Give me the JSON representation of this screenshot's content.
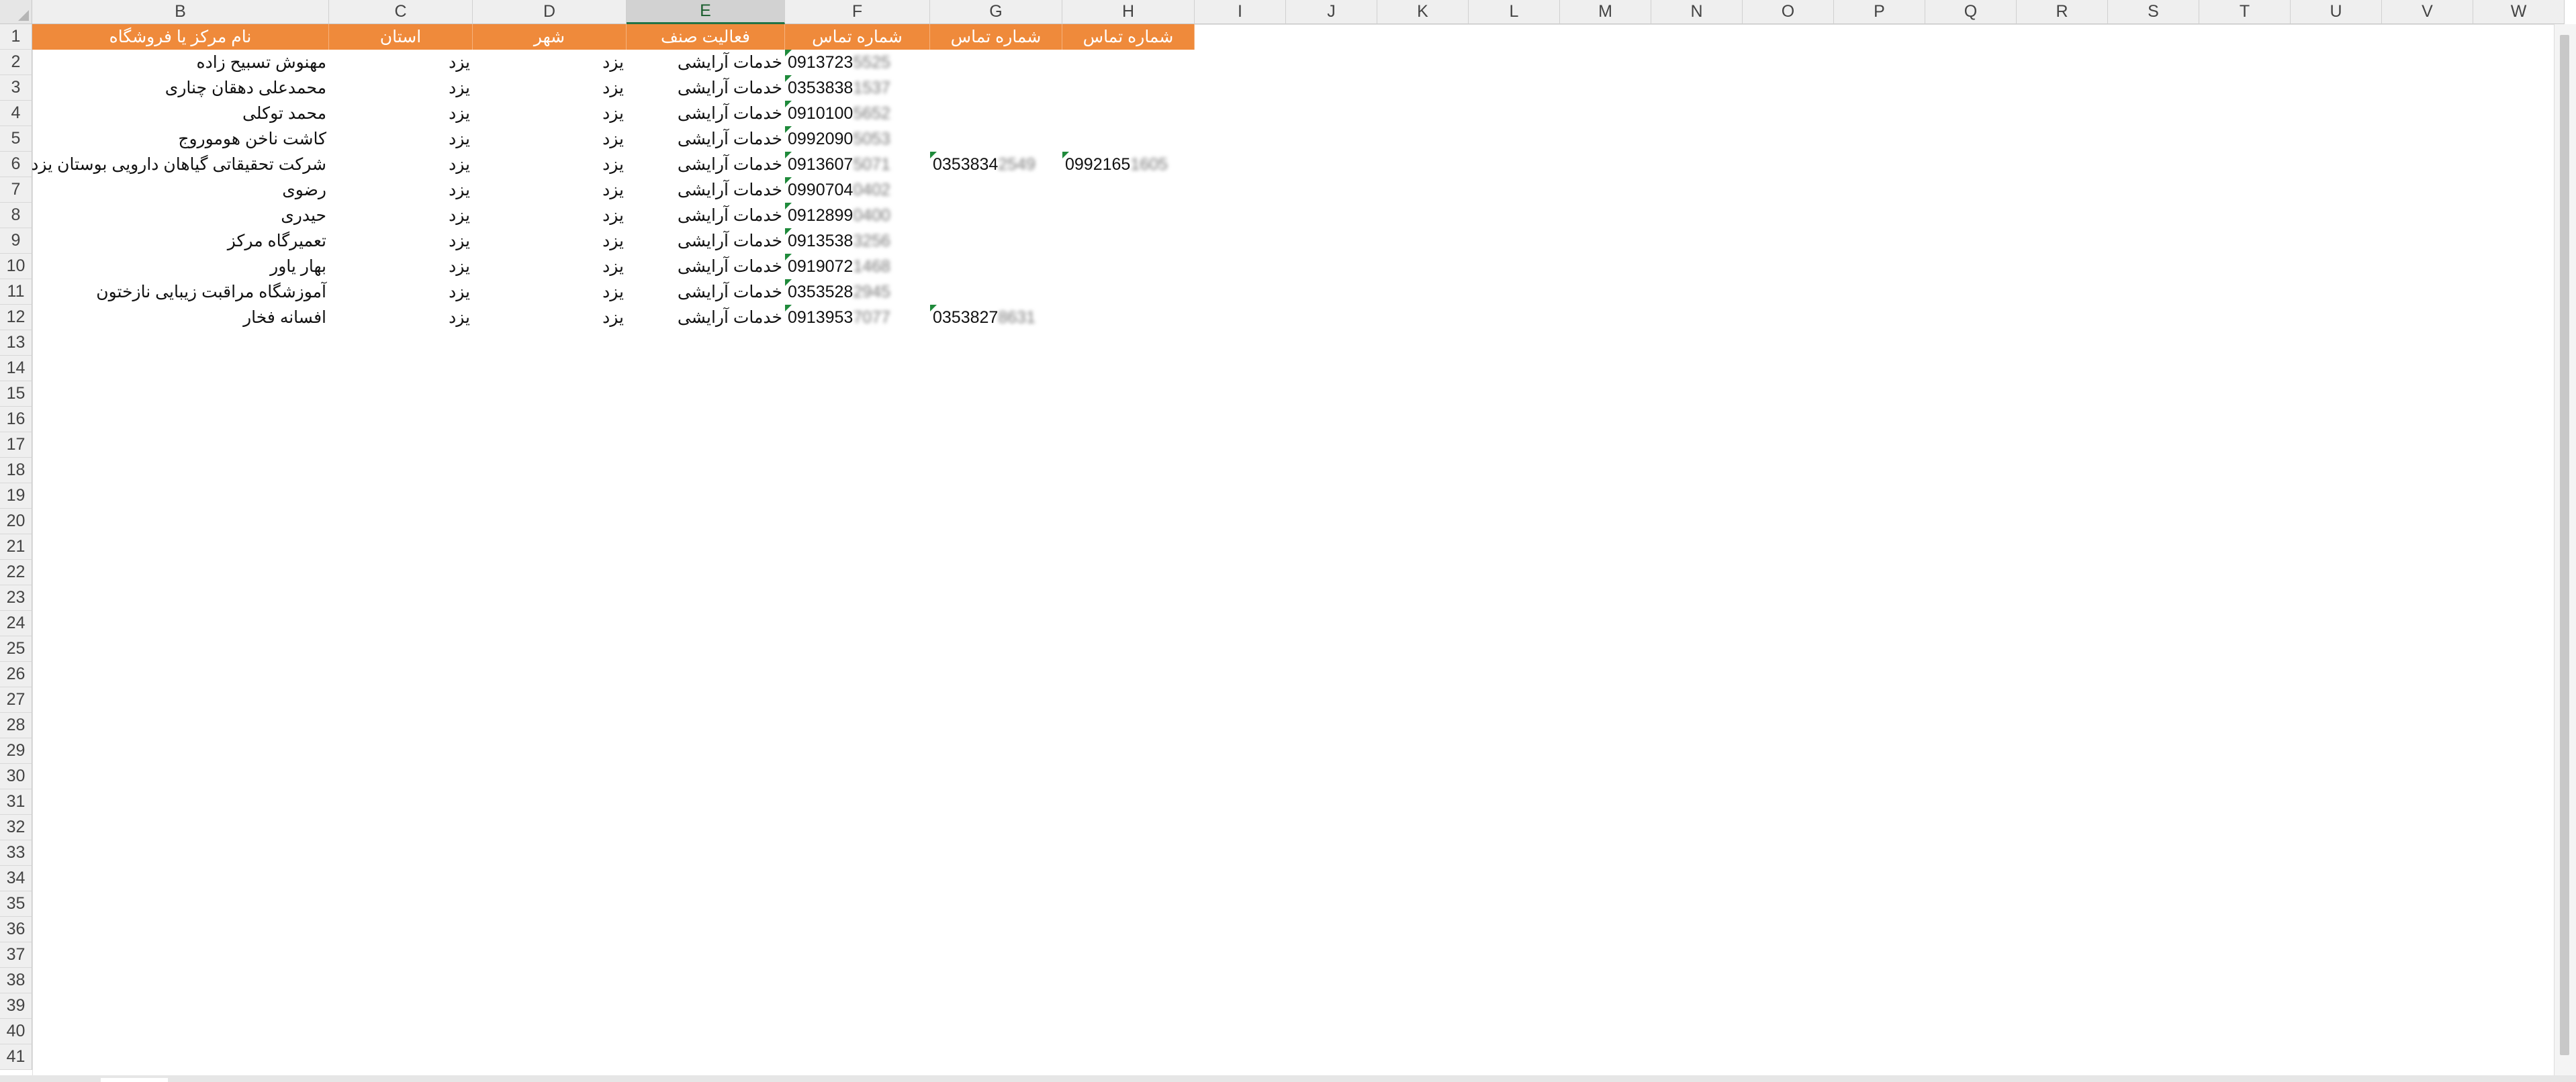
{
  "columns": [
    "B",
    "C",
    "D",
    "E",
    "F",
    "G",
    "H",
    "I",
    "J",
    "K",
    "L",
    "M",
    "N",
    "O",
    "P",
    "Q",
    "R",
    "S",
    "T",
    "U",
    "V",
    "W"
  ],
  "selected_column": "E",
  "row_numbers": [
    "1",
    "2",
    "3",
    "4",
    "5",
    "6",
    "7",
    "8",
    "9",
    "10",
    "11",
    "12",
    "13",
    "14",
    "15",
    "16",
    "17",
    "18",
    "19",
    "20",
    "21",
    "22",
    "23",
    "24",
    "25",
    "26",
    "27",
    "28",
    "29",
    "30",
    "31",
    "32",
    "33",
    "34",
    "35",
    "36",
    "37",
    "38",
    "39",
    "40",
    "41"
  ],
  "header_row": {
    "name": "نام مرکز یا فروشگاه",
    "province": "استان",
    "city": "شهر",
    "activity": "فعالیت صنف",
    "phone1": "شماره تماس",
    "phone2": "شماره تماس",
    "phone3": "شماره تماس"
  },
  "rows": [
    {
      "name": "مهنوش تسبیح زاده",
      "province": "یزد",
      "city": "یزد",
      "activity": "خدمات آرایشی",
      "phone1": "0913723",
      "phone1_hidden": "5525",
      "phone2": "",
      "phone2_hidden": "",
      "phone3": "",
      "phone3_hidden": ""
    },
    {
      "name": "محمدعلی دهقان چناری",
      "province": "یزد",
      "city": "یزد",
      "activity": "خدمات آرایشی",
      "phone1": "0353838",
      "phone1_hidden": "1537",
      "phone2": "",
      "phone2_hidden": "",
      "phone3": "",
      "phone3_hidden": ""
    },
    {
      "name": "محمد توکلی",
      "province": "یزد",
      "city": "یزد",
      "activity": "خدمات آرایشی",
      "phone1": "0910100",
      "phone1_hidden": "5652",
      "phone2": "",
      "phone2_hidden": "",
      "phone3": "",
      "phone3_hidden": ""
    },
    {
      "name": "کاشت ناخن هوموروج",
      "province": "یزد",
      "city": "یزد",
      "activity": "خدمات آرایشی",
      "phone1": "0992090",
      "phone1_hidden": "5053",
      "phone2": "",
      "phone2_hidden": "",
      "phone3": "",
      "phone3_hidden": ""
    },
    {
      "name": "شرکت تحقیقاتی گیاهان دارویی بوستان یزد",
      "province": "یزد",
      "city": "یزد",
      "activity": "خدمات آرایشی",
      "phone1": "0913607",
      "phone1_hidden": "5071",
      "phone2": "0353834",
      "phone2_hidden": "2549",
      "phone3": "0992165",
      "phone3_hidden": "1605"
    },
    {
      "name": "رضوی",
      "province": "یزد",
      "city": "یزد",
      "activity": "خدمات آرایشی",
      "phone1": "0990704",
      "phone1_hidden": "0402",
      "phone2": "",
      "phone2_hidden": "",
      "phone3": "",
      "phone3_hidden": ""
    },
    {
      "name": "حیدری",
      "province": "یزد",
      "city": "یزد",
      "activity": "خدمات آرایشی",
      "phone1": "0912899",
      "phone1_hidden": "0400",
      "phone2": "",
      "phone2_hidden": "",
      "phone3": "",
      "phone3_hidden": ""
    },
    {
      "name": "تعمیرگاه مرکز",
      "province": "یزد",
      "city": "یزد",
      "activity": "خدمات آرایشی",
      "phone1": "0913538",
      "phone1_hidden": "3256",
      "phone2": "",
      "phone2_hidden": "",
      "phone3": "",
      "phone3_hidden": ""
    },
    {
      "name": "بهار یاور",
      "province": "یزد",
      "city": "یزد",
      "activity": "خدمات آرایشی",
      "phone1": "0919072",
      "phone1_hidden": "1468",
      "phone2": "",
      "phone2_hidden": "",
      "phone3": "",
      "phone3_hidden": ""
    },
    {
      "name": "آموزشگاه مراقبت زیبایی نازختون",
      "province": "یزد",
      "city": "یزد",
      "activity": "خدمات آرایشی",
      "phone1": "0353528",
      "phone1_hidden": "2945",
      "phone2": "",
      "phone2_hidden": "",
      "phone3": "",
      "phone3_hidden": ""
    },
    {
      "name": "افسانه فخار",
      "province": "یزد",
      "city": "یزد",
      "activity": "خدمات آرایشی",
      "phone1": "0913953",
      "phone1_hidden": "7077",
      "phone2": "0353827",
      "phone2_hidden": "8631",
      "phone3": "",
      "phone3_hidden": ""
    }
  ],
  "colors": {
    "header_fill": "#ef8a3b",
    "header_text": "#ffffff",
    "error_indicator": "#1f8a3b",
    "selected_column_accent": "#217346"
  }
}
